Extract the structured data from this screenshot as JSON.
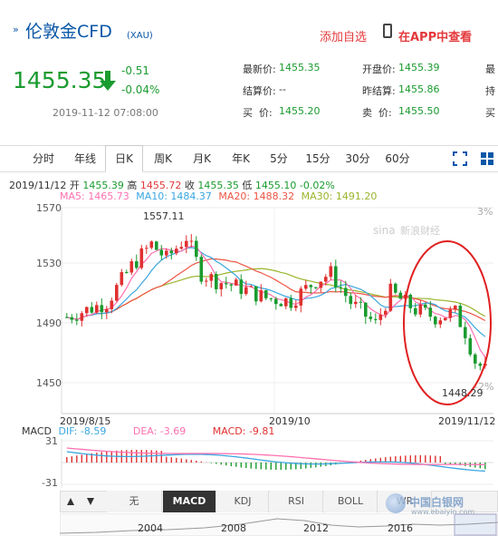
{
  "header": {
    "title": "伦敦金CFD",
    "subtitle": "(XAU)",
    "add_watch": "添加自选",
    "app_link": "在APP中查看"
  },
  "quote": {
    "price": "1455.35",
    "change": "-0.51",
    "change_pct": "-0.04%",
    "datetime": "2019-11-12 07:08:00"
  },
  "fields": {
    "latest_label": "最新价:",
    "latest": "1455.35",
    "open_label": "开盘价:",
    "open": "1455.39",
    "more1": "最",
    "settle_label": "结算价:",
    "settle": "--",
    "prev_settle_label": "昨结算:",
    "prev_settle": "1455.86",
    "more2": "持",
    "bid_label": "买  价:",
    "bid": "1455.20",
    "ask_label": "卖  价:",
    "ask": "1455.50",
    "more3": "买"
  },
  "tabs": [
    "分时",
    "年线",
    "日K",
    "周K",
    "月K",
    "年K",
    "5分",
    "15分",
    "30分",
    "60分"
  ],
  "active_tab": "日K",
  "ohlc_line": {
    "date": "2019/11/12",
    "open_label": "开",
    "open": "1455.39",
    "high_label": "高",
    "high": "1455.72",
    "close_label": "收",
    "close": "1455.35",
    "low_label": "低",
    "low": "1455.10",
    "change": "-0.02%"
  },
  "ma": {
    "ma5": "MA5: 1465.73",
    "ma10": "MA10: 1484.37",
    "ma20": "MA20: 1488.32",
    "ma30": "MA30: 1491.20"
  },
  "colors": {
    "ma5": "#ff70b0",
    "ma10": "#3aa6e0",
    "ma20": "#ee5544",
    "ma30": "#99b52c",
    "up": "#e03030",
    "down": "#1a9b2f"
  },
  "chart": {
    "y_ticks": [
      "1570",
      "1530",
      "1490",
      "1450"
    ],
    "pct_top": "3%",
    "pct_bottom": "-2%",
    "high_label": "1557.11",
    "low_label": "1448.29",
    "x_labels": [
      "2019/8/15",
      "2019/10",
      "2019/11/12"
    ],
    "watermark": "新浪财经"
  },
  "macd": {
    "label": "MACD",
    "dif": "DIF: -8.59",
    "dea": "DEA: -3.69",
    "macd": "MACD: -9.81",
    "y_ticks": [
      "31",
      "-31"
    ]
  },
  "indicators": [
    "无",
    "MACD",
    "KDJ",
    "RSI",
    "BOLL",
    "WR"
  ],
  "active_indicator": "MACD",
  "timeline_years": [
    "2004",
    "2008",
    "2012",
    "2016"
  ],
  "footer_watermark": {
    "name": "中国白银网",
    "url": "www.ebaiyin.com"
  }
}
